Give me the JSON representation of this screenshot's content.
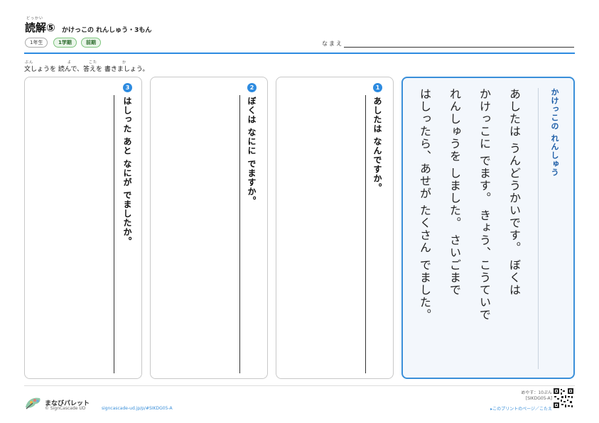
{
  "header": {
    "title_furigana": "どっかい",
    "title": "読解⑤",
    "subtitle": "かけっこの れんしゅう・3もん",
    "tags": [
      "1年生",
      "1学期",
      "前期"
    ],
    "name_label": "なまえ"
  },
  "instruction": {
    "furigana": [
      "ぶん",
      "よ",
      "こた",
      "か"
    ],
    "text": "文しょうを 読んで、答えを 書きましょう。"
  },
  "questions": [
    {
      "number": "3",
      "text": "はしった あと なにが でましたか。"
    },
    {
      "number": "2",
      "text": "ぼくは なにに でますか。"
    },
    {
      "number": "1",
      "text": "あしたは なんですか。"
    }
  ],
  "story": {
    "title": "かけっこの れんしゅう",
    "lines": [
      "あしたは うんどうかいです。 ぼくは",
      "かけっこに でます。 きょう、こうていで",
      "れんしゅうを しました。 さいごまで",
      "はしったら、あせが たくさん でました。"
    ]
  },
  "footer": {
    "brand": "まなびパレット",
    "copyright": "© SignCascade UD",
    "url": "signcascade-ud.jp/p/#SIKDG05-A",
    "meyasu": "めやす：10ぷん",
    "code": "[SIKDG05-A]",
    "link": "▸このプリントのページ／こたえ"
  },
  "colors": {
    "accent": "#2d8be0",
    "tag_green": "#7cc47c",
    "story_border": "#3a8fd9"
  }
}
